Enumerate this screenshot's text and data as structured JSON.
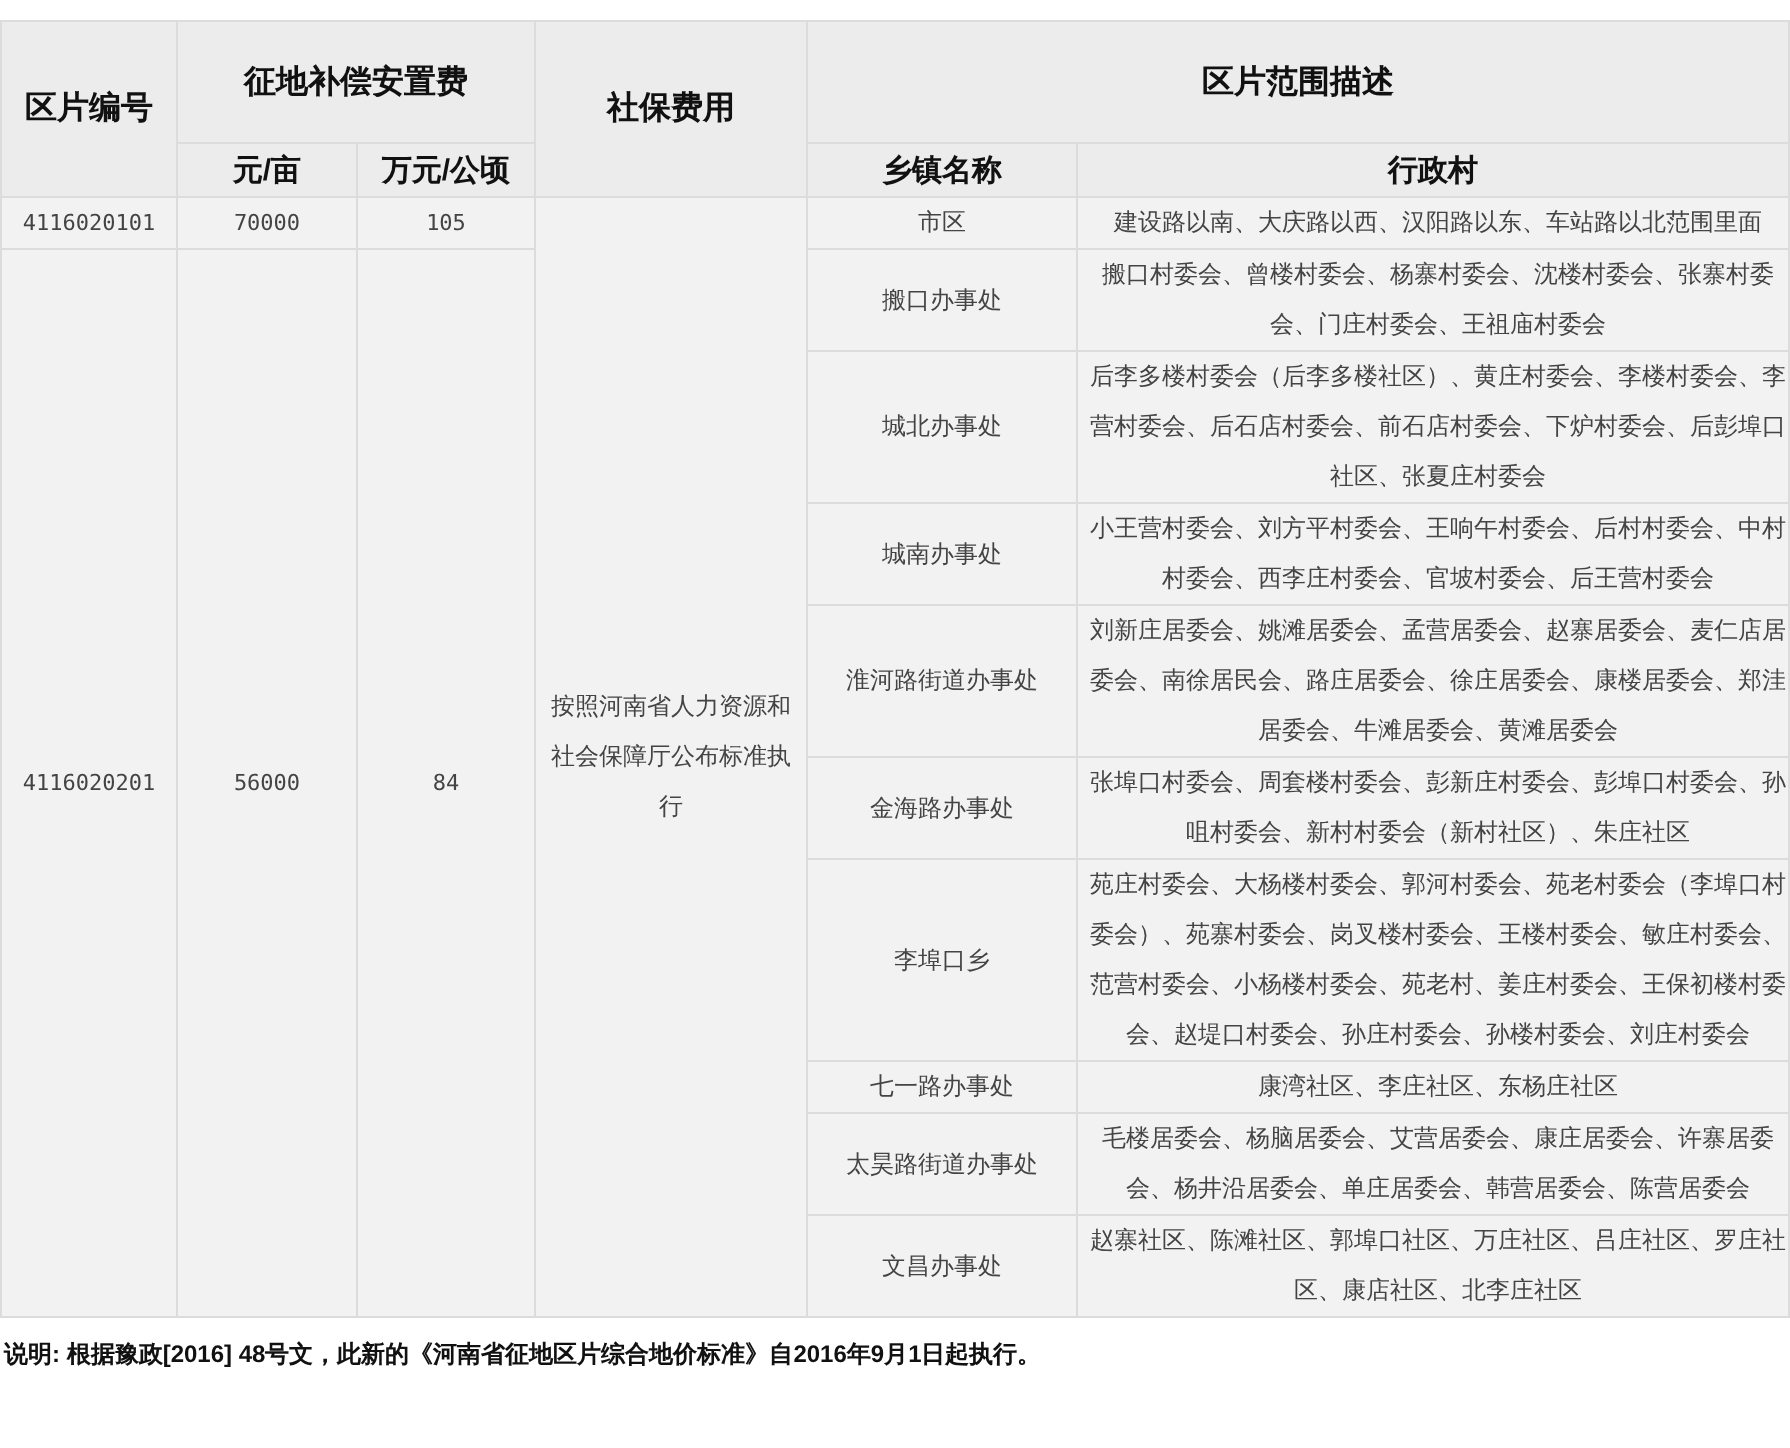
{
  "table": {
    "headers": {
      "zone_code": "区片编号",
      "compensation": "征地补偿安置费",
      "per_mu": "元/亩",
      "per_hectare": "万元/公顷",
      "social_security": "社保费用",
      "description": "区片范围描述",
      "town": "乡镇名称",
      "villages": "行政村"
    },
    "social_security_text": "按照河南省人力资源和社会保障厅公布标准执行",
    "zones": [
      {
        "code": "4116020101",
        "per_mu": "70000",
        "per_hectare": "105",
        "towns": [
          {
            "name": "市区",
            "villages": "建设路以南、大庆路以西、汉阳路以东、车站路以北范围里面"
          }
        ]
      },
      {
        "code": "4116020201",
        "per_mu": "56000",
        "per_hectare": "84",
        "towns": [
          {
            "name": "搬口办事处",
            "villages": "搬口村委会、曾楼村委会、杨寨村委会、沈楼村委会、张寨村委会、门庄村委会、王祖庙村委会"
          },
          {
            "name": "城北办事处",
            "villages": "后李多楼村委会（后李多楼社区）、黄庄村委会、李楼村委会、李营村委会、后石店村委会、前石店村委会、下炉村委会、后彭埠口社区、张夏庄村委会"
          },
          {
            "name": "城南办事处",
            "villages": "小王营村委会、刘方平村委会、王响午村委会、后村村委会、中村村委会、西李庄村委会、官坡村委会、后王营村委会"
          },
          {
            "name": "淮河路街道办事处",
            "villages": "刘新庄居委会、姚滩居委会、孟营居委会、赵寨居委会、麦仁店居委会、南徐居民会、路庄居委会、徐庄居委会、康楼居委会、郑洼居委会、牛滩居委会、黄滩居委会"
          },
          {
            "name": "金海路办事处",
            "villages": "张埠口村委会、周套楼村委会、彭新庄村委会、彭埠口村委会、孙咀村委会、新村村委会（新村社区）、朱庄社区"
          },
          {
            "name": "李埠口乡",
            "villages": "苑庄村委会、大杨楼村委会、郭河村委会、苑老村委会（李埠口村委会）、苑寨村委会、岗叉楼村委会、王楼村委会、敏庄村委会、范营村委会、小杨楼村委会、苑老村、姜庄村委会、王保初楼村委会、赵堤口村委会、孙庄村委会、孙楼村委会、刘庄村委会"
          },
          {
            "name": "七一路办事处",
            "villages": "康湾社区、李庄社区、东杨庄社区"
          },
          {
            "name": "太昊路街道办事处",
            "villages": "毛楼居委会、杨脑居委会、艾营居委会、康庄居委会、许寨居委会、杨井沿居委会、单庄居委会、韩营居委会、陈营居委会"
          },
          {
            "name": "文昌办事处",
            "villages": "赵寨社区、陈滩社区、郭埠口社区、万庄社区、吕庄社区、罗庄社区、康店社区、北李庄社区"
          }
        ]
      }
    ]
  },
  "note": "说明: 根据豫政[2016] 48号文，此新的《河南省征地区片综合地价标准》自2016年9月1日起执行。"
}
